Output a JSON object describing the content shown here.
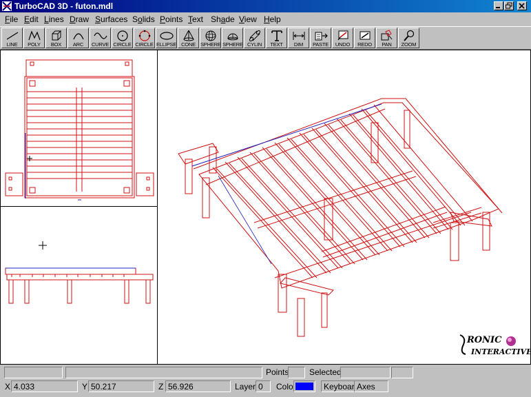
{
  "window": {
    "title": "TurboCAD 3D - futon.mdl"
  },
  "menu": [
    {
      "pre": "",
      "u": "F",
      "post": "ile"
    },
    {
      "pre": "",
      "u": "E",
      "post": "dit"
    },
    {
      "pre": "",
      "u": "L",
      "post": "ines"
    },
    {
      "pre": "",
      "u": "D",
      "post": "raw"
    },
    {
      "pre": "",
      "u": "S",
      "post": "urfaces"
    },
    {
      "pre": "S",
      "u": "o",
      "post": "lids"
    },
    {
      "pre": "",
      "u": "P",
      "post": "oints"
    },
    {
      "pre": "",
      "u": "T",
      "post": "ext"
    },
    {
      "pre": "Sh",
      "u": "a",
      "post": "de"
    },
    {
      "pre": "",
      "u": "V",
      "post": "iew"
    },
    {
      "pre": "",
      "u": "H",
      "post": "elp"
    }
  ],
  "toolbar": {
    "line": "LINE",
    "poly": "POLY",
    "box": "BOX",
    "arc": "ARC",
    "curve": "CURVE",
    "circle1": "CIRCLE",
    "circle2": "CIRCLE",
    "ellipse": "ELLIPSE",
    "cone": "CONE",
    "sphere1": "SPHERE",
    "sphere2": "SPHERE",
    "cylin": "CYLIN",
    "text": "TEXT",
    "dim": "DIM",
    "paste": "PASTE",
    "undo": "UNDO",
    "redo": "REDO",
    "pan": "PAN",
    "zoom": "ZOOM"
  },
  "status": {
    "points_label": "Points",
    "selected_label": "Selected",
    "x_label": "X",
    "x_value": "4.033",
    "y_label": "Y",
    "y_value": "50.217",
    "z_label": "Z",
    "z_value": "56.926",
    "layer_label": "Layer",
    "layer_value": "0",
    "color_label": "Color",
    "color_value": "#0000ff",
    "keyboard_label": "Keyboard",
    "axes_label": "Axes"
  },
  "logo": {
    "line1": "RONIC",
    "line2": "INTERACTIVE"
  },
  "colors": {
    "wire": "#d01010",
    "accent": "#2020c0"
  }
}
